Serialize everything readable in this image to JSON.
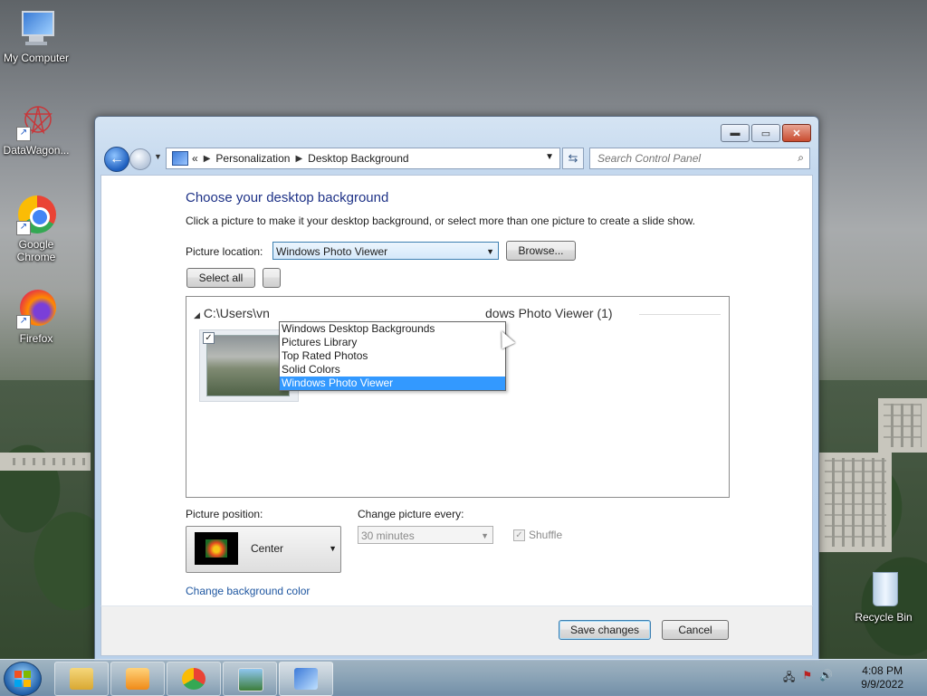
{
  "desktop": {
    "icons": [
      {
        "label": "My Computer"
      },
      {
        "label": "DataWagon..."
      },
      {
        "label": "Google Chrome"
      },
      {
        "label": "Firefox"
      },
      {
        "label": "Recycle Bin"
      }
    ]
  },
  "window": {
    "controls": {
      "minimize": "▬",
      "maximize": "▭",
      "close": "✕"
    },
    "breadcrumb": {
      "chevrons": "«",
      "items": [
        "Personalization",
        "Desktop Background"
      ]
    },
    "search_placeholder": "Search Control Panel"
  },
  "main": {
    "title": "Choose your desktop background",
    "description": "Click a picture to make it your desktop background, or select more than one picture to create a slide show.",
    "picture_location_label": "Picture location:",
    "picture_location_value": "Windows Photo Viewer",
    "browse_label": "Browse...",
    "select_all_label": "Select all",
    "dropdown_options": [
      "Windows Desktop Backgrounds",
      "Pictures Library",
      "Top Rated Photos",
      "Solid Colors",
      "Windows Photo Viewer"
    ],
    "group_header_left": "C:\\Users\\vn",
    "group_header_right": "dows Photo Viewer (1)",
    "thumbnail_checked": "✓",
    "picture_position_label": "Picture position:",
    "picture_position_value": "Center",
    "change_every_label": "Change picture every:",
    "change_every_value": "30 minutes",
    "shuffle_label": "Shuffle",
    "change_bg_link": "Change background color"
  },
  "footer": {
    "save_label": "Save changes",
    "cancel_label": "Cancel"
  },
  "taskbar": {
    "time": "4:08 PM",
    "date": "9/9/2022"
  }
}
